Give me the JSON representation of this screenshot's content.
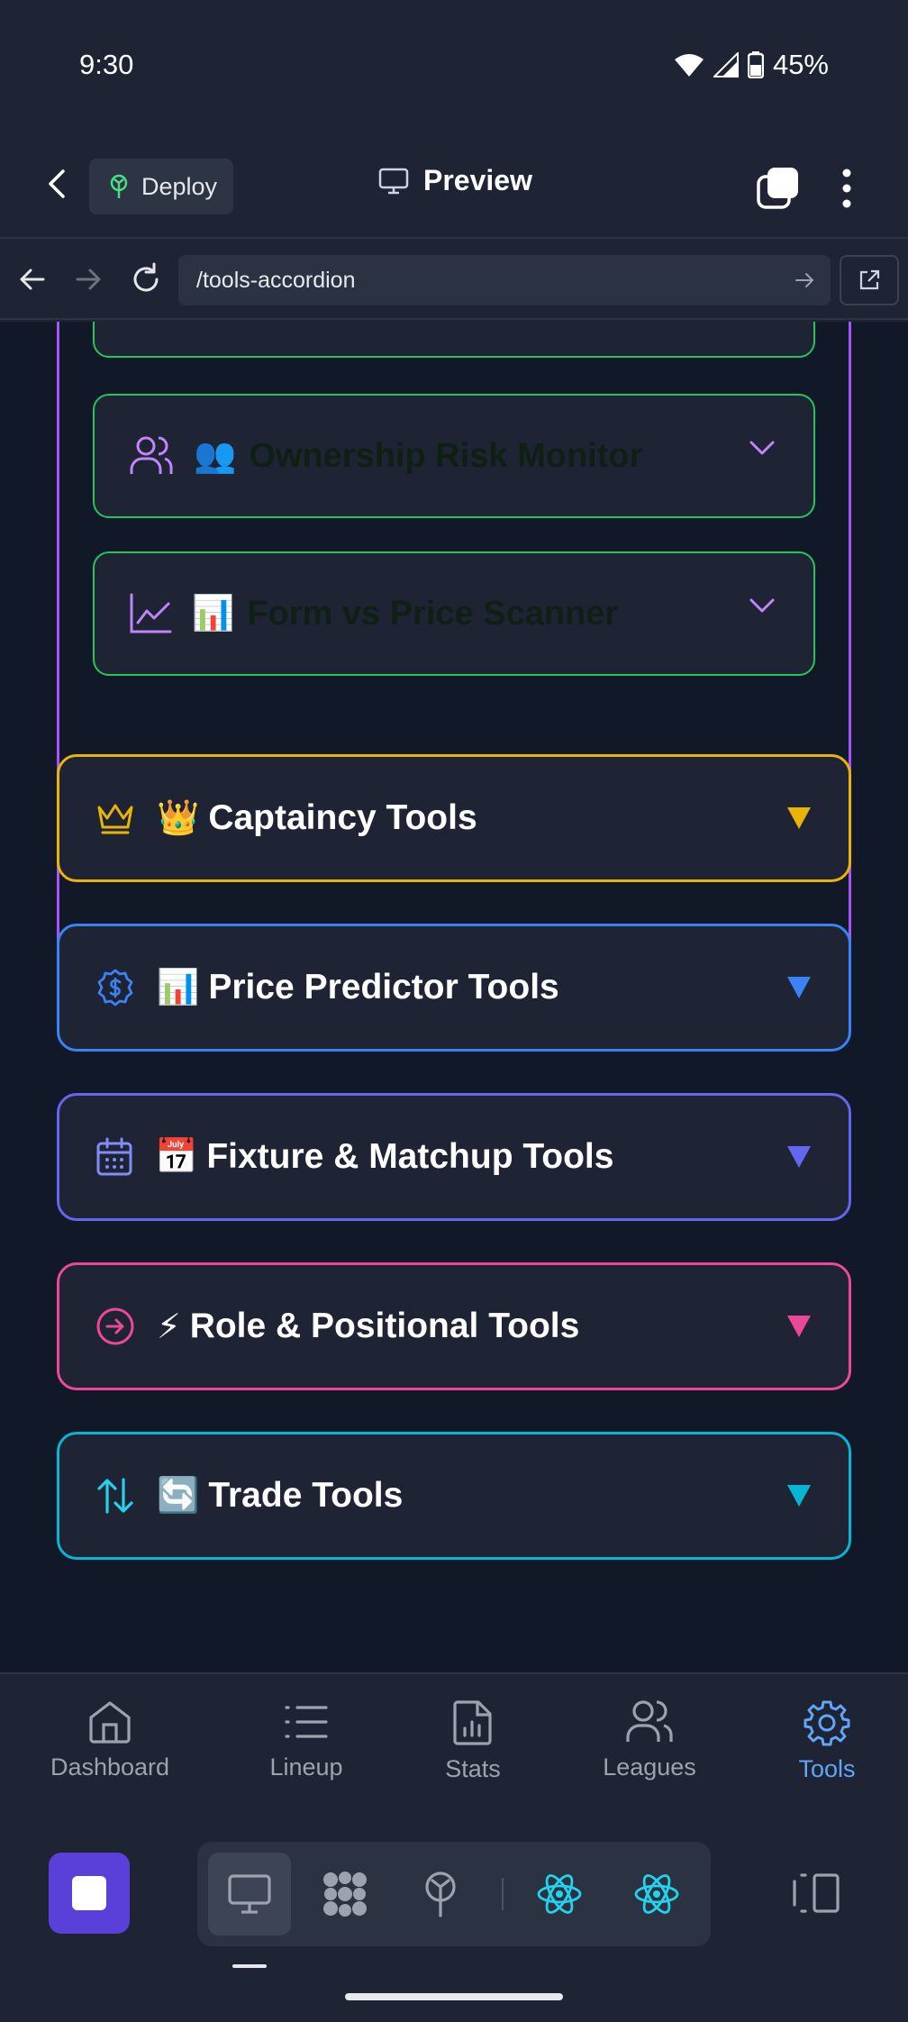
{
  "status_bar": {
    "time": "9:30",
    "battery": "45%"
  },
  "app_bar": {
    "deploy_label": "Deploy",
    "preview_label": "Preview"
  },
  "url_bar": {
    "url": "/tools-accordion"
  },
  "sub_tools": [
    {
      "emoji": "👥",
      "title": "Ownership Risk Monitor",
      "icon": "users-icon"
    },
    {
      "emoji": "📊",
      "title": "Form vs Price Scanner",
      "icon": "line-chart-icon"
    }
  ],
  "tool_sections": [
    {
      "emoji": "👑",
      "title": "Captaincy Tools",
      "color": "#eab308",
      "icon": "crown-icon"
    },
    {
      "emoji": "📊",
      "title": "Price Predictor Tools",
      "color": "#3b82f6",
      "icon": "dollar-badge-icon"
    },
    {
      "emoji": "📅",
      "title": "Fixture & Matchup Tools",
      "color": "#6366f1",
      "icon": "calendar-icon"
    },
    {
      "emoji": "⚡",
      "title": "Role & Positional Tools",
      "color": "#ec4899",
      "icon": "arrow-circle-icon"
    },
    {
      "emoji": "🔄",
      "title": "Trade Tools",
      "color": "#06b6d4",
      "icon": "swap-arrows-icon"
    }
  ],
  "colors": {
    "green_border": "#22c55e",
    "purple_border": "#a855f7",
    "active_tab": "#60a5fa"
  },
  "tabs": [
    {
      "label": "Dashboard",
      "icon": "home-icon",
      "active": false
    },
    {
      "label": "Lineup",
      "icon": "list-icon",
      "active": false
    },
    {
      "label": "Stats",
      "icon": "file-chart-icon",
      "active": false
    },
    {
      "label": "Leagues",
      "icon": "users-icon",
      "active": false
    },
    {
      "label": "Tools",
      "icon": "gear-icon",
      "active": true
    }
  ]
}
